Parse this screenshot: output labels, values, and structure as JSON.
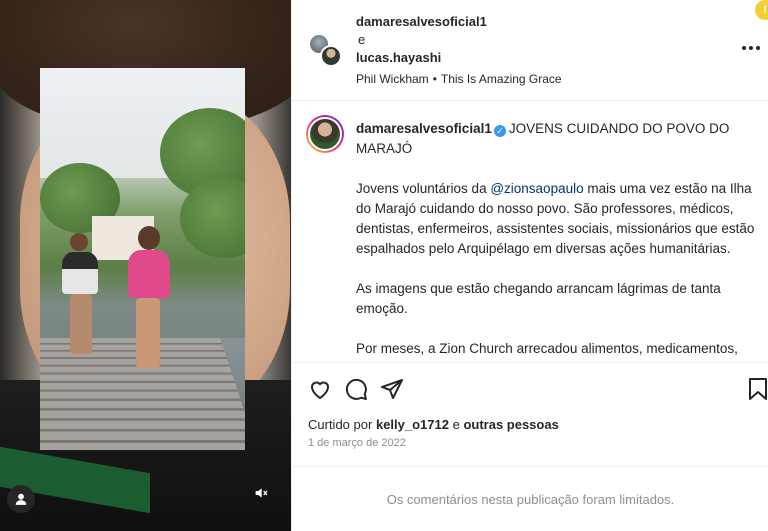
{
  "header": {
    "user1": "damaresalvesoficial1",
    "and": "e",
    "user2": "lucas.hayashi",
    "music_artist": "Phil Wickham",
    "music_separator": "•",
    "music_title": "This Is Amazing Grace",
    "notification_glyph": "!"
  },
  "caption": {
    "username": "damaresalvesoficial1",
    "title": "JOVENS CUIDANDO DO POVO DO MARAJÓ",
    "p1_before": "Jovens voluntários da ",
    "p1_mention": "@zionsaopaulo",
    "p1_after": " mais uma vez estão na Ilha do Marajó cuidando do nosso povo. São professores, médicos, dentistas, enfermeiros, assistentes sociais, missionários que estão espalhados pelo Arquipélago em diversas ações humanitárias.",
    "p2": "As imagens que estão chegando arrancam lágrimas de tanta emoção.",
    "p3": "Por meses, a Zion Church arrecadou alimentos, medicamentos, remédios, brinquedos para esta missão. Foram mais se 700 mil reais em doações."
  },
  "likes": {
    "prefix": "Curtido por",
    "user": "kelly_o1712",
    "connector": "e",
    "others": "outras pessoas"
  },
  "date": "1 de março de 2022",
  "comments_notice": "Os comentários nesta publicação foram limitados.",
  "icons": {
    "like": "heart-icon",
    "comment": "comment-icon",
    "share": "share-icon",
    "save": "bookmark-icon",
    "more": "more-icon",
    "mute": "muted-icon",
    "tagged": "user-icon"
  },
  "colors": {
    "verified": "#3897f0",
    "mention": "#00376b",
    "secondary_text": "#8e8e8e",
    "notification": "#f4cf34"
  }
}
